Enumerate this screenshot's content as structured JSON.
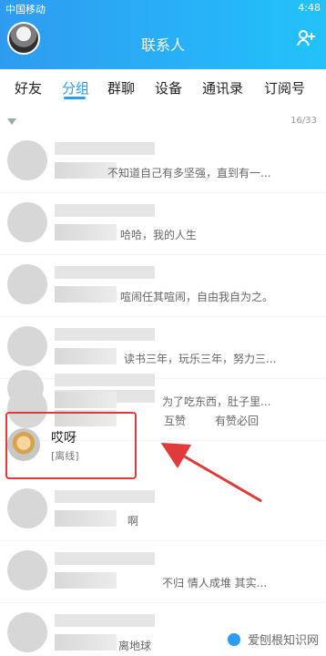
{
  "status_bar": {
    "carrier": "中国移动",
    "network": "4G",
    "time": "4:48"
  },
  "header": {
    "title": "联系人"
  },
  "tabs": [
    {
      "label": "好友"
    },
    {
      "label": "分组"
    },
    {
      "label": "群聊"
    },
    {
      "label": "设备"
    },
    {
      "label": "通讯录"
    },
    {
      "label": "订阅号"
    }
  ],
  "group": {
    "count": "16/33"
  },
  "contacts": [
    {
      "message": "不知道自己有多坚强，直到有一..."
    },
    {
      "message": "哈哈，我的人生"
    },
    {
      "message": "喧闹任其喧闹，自由我自为之。"
    },
    {
      "message": "读书三年，玩乐三年，努力三..."
    },
    {
      "message_a": "互赞",
      "message_b": "有赞必回"
    },
    {
      "message": "为了吃东西，肚子里..."
    },
    {
      "name": "哎呀",
      "status": "[离线]"
    },
    {
      "message": "啊"
    },
    {
      "message": "不归 情人成堆 其实..."
    },
    {
      "message": "离地球"
    }
  ],
  "watermark": {
    "text": "爱刨根知识网"
  },
  "colors": {
    "accent": "#2a9df4",
    "highlight": "#e03a3a"
  }
}
